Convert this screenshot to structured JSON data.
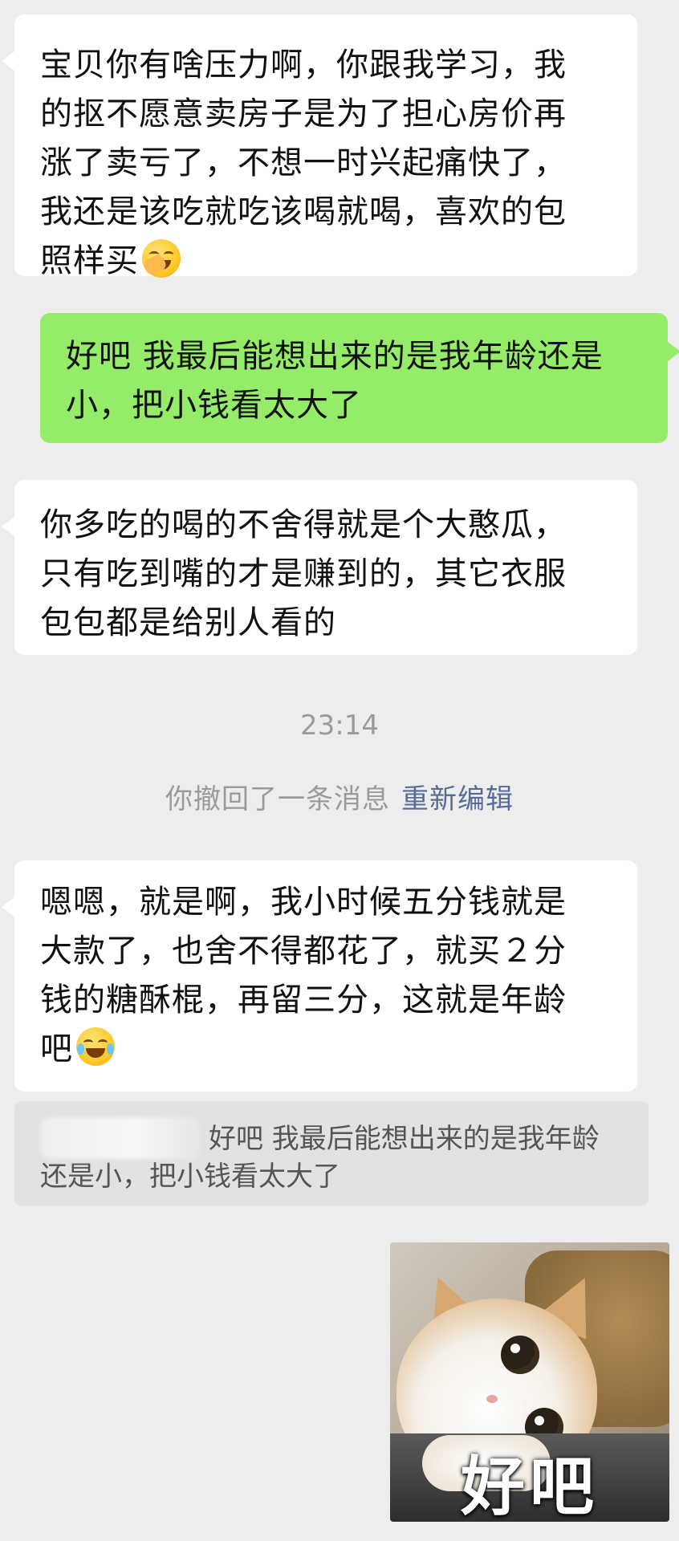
{
  "messages": [
    {
      "direction": "incoming",
      "lines": [
        "宝贝你有啥压力啊，你跟我学习，我",
        "的抠不愿意卖房子是为了担心房价再",
        "涨了卖亏了，不想一时兴起痛快了，",
        "我还是该吃就吃该喝就喝，喜欢的包",
        "照样买"
      ],
      "emoji": "face-palm-emoji"
    },
    {
      "direction": "outgoing",
      "lines": [
        "好吧 我最后能想出来的是我年龄还是",
        "小，把小钱看太大了"
      ]
    },
    {
      "direction": "incoming",
      "lines": [
        "你多吃的喝的不舍得就是个大憨瓜，",
        "只有吃到嘴的才是赚到的，其它衣服",
        "包包都是给别人看的"
      ]
    },
    {
      "direction": "incoming",
      "lines": [
        "嗯嗯，就是啊，我小时候五分钱就是",
        "大款了，也舍不得都花了，就买２分",
        "钱的糖酥棍，再留三分，这就是年龄",
        "吧"
      ],
      "emoji": "tears-of-joy-emoji"
    }
  ],
  "timestamp": "23:14",
  "recall": {
    "text": "你撤回了一条消息",
    "link": "重新编辑"
  },
  "quote": {
    "lines": [
      "好吧 我最后能想出来的是我年龄",
      "还是小，把小钱看太大了"
    ]
  },
  "sticker": {
    "caption": "好吧",
    "icon": "cat-sticker"
  },
  "colors": {
    "background": "#ededed",
    "incoming_bubble": "#ffffff",
    "outgoing_bubble": "#95ec69",
    "link": "#576b95",
    "system_text": "#9a9a9a"
  }
}
